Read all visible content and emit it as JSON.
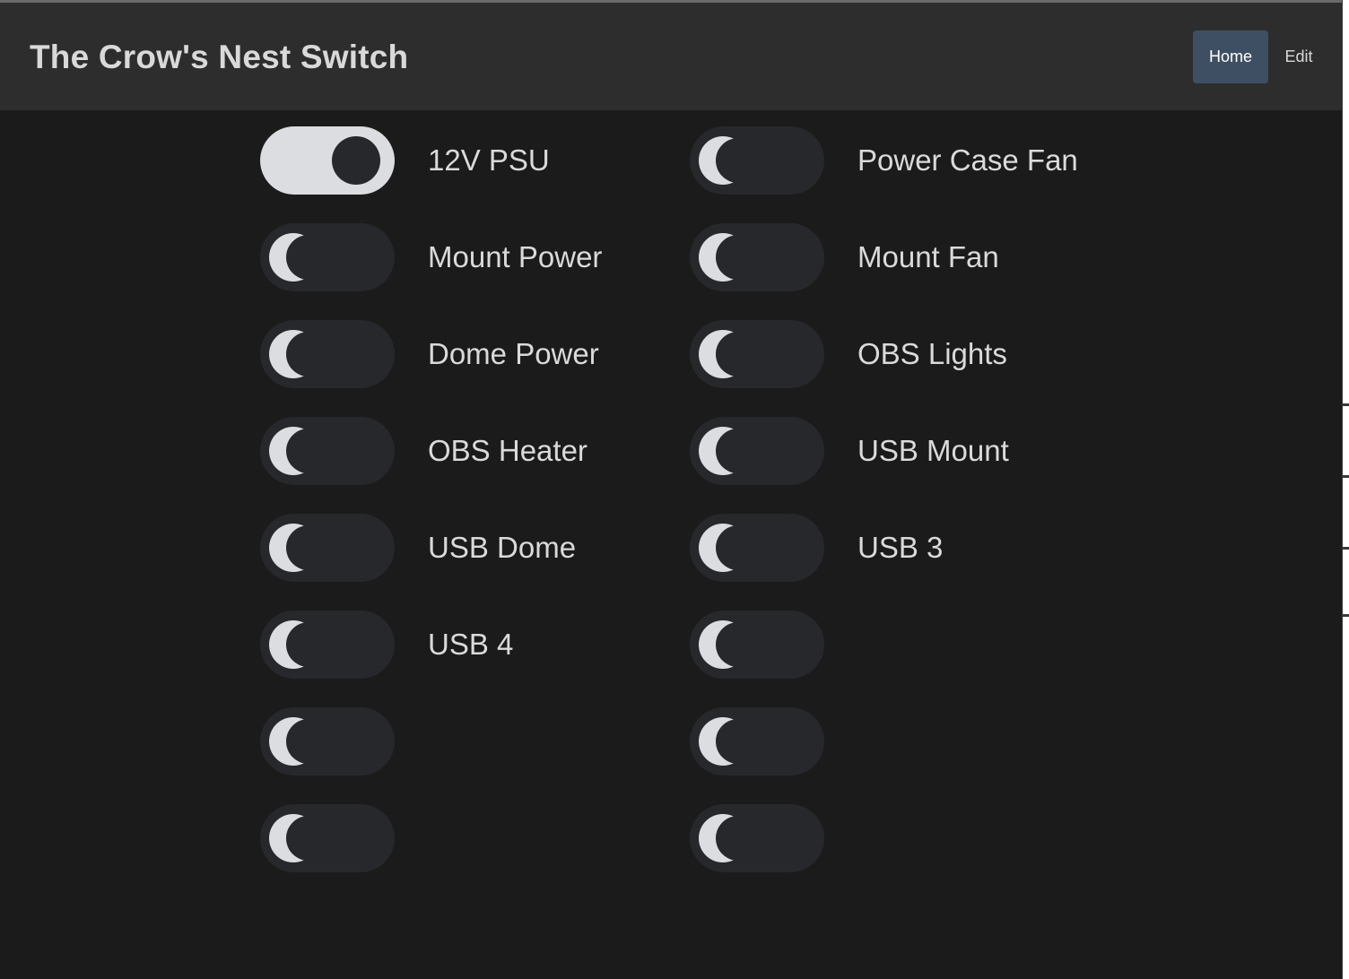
{
  "app": {
    "title": "The Crow's Nest Switch"
  },
  "nav": {
    "home_label": "Home",
    "edit_label": "Edit",
    "active": "Home"
  },
  "colors": {
    "background": "#1b1b1b",
    "header": "#2d2d2d",
    "active_nav": "#3f4f63",
    "toggle_track_off": "#27282b",
    "toggle_track_on": "#dcdde0"
  },
  "switches": {
    "left": [
      {
        "label": "12V PSU",
        "state": "on"
      },
      {
        "label": "Mount Power",
        "state": "off"
      },
      {
        "label": "Dome Power",
        "state": "off"
      },
      {
        "label": "OBS Heater",
        "state": "off"
      },
      {
        "label": "USB Dome",
        "state": "off"
      },
      {
        "label": "USB 4",
        "state": "off"
      },
      {
        "label": "",
        "state": "off"
      },
      {
        "label": "",
        "state": "off"
      }
    ],
    "right": [
      {
        "label": "Power Case Fan",
        "state": "off"
      },
      {
        "label": "Mount Fan",
        "state": "off"
      },
      {
        "label": "OBS Lights",
        "state": "off"
      },
      {
        "label": "USB Mount",
        "state": "off"
      },
      {
        "label": "USB 3",
        "state": "off"
      },
      {
        "label": "",
        "state": "off"
      },
      {
        "label": "",
        "state": "off"
      },
      {
        "label": "",
        "state": "off"
      }
    ]
  }
}
